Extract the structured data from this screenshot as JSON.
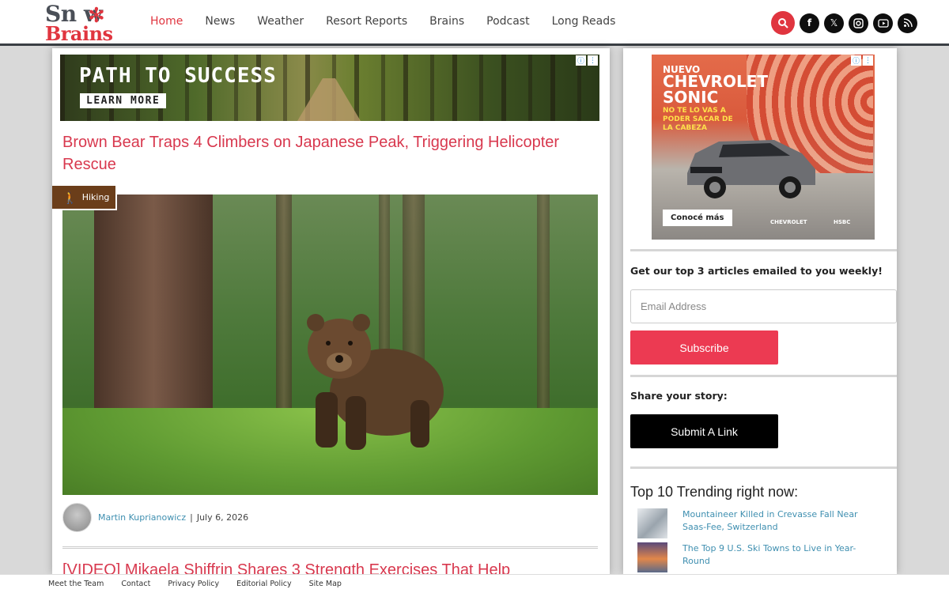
{
  "logo": {
    "line1": "Sn  w",
    "line2": "Brains"
  },
  "nav": {
    "items": [
      {
        "label": "Home",
        "active": true
      },
      {
        "label": "News"
      },
      {
        "label": "Weather"
      },
      {
        "label": "Resort Reports"
      },
      {
        "label": "Brains"
      },
      {
        "label": "Podcast"
      },
      {
        "label": "Long Reads"
      }
    ]
  },
  "social": [
    "search-icon",
    "facebook-icon",
    "x-icon",
    "instagram-icon",
    "youtube-icon",
    "rss-icon"
  ],
  "banner_ad": {
    "headline": "PATH TO SUCCESS",
    "cta": "LEARN MORE"
  },
  "article": {
    "title": "Brown Bear Traps 4 Climbers on Japanese Peak, Triggering Helicopter Rescue",
    "category": "Hiking",
    "author": "Martin Kuprianowicz",
    "date": "July 6, 2026",
    "separator": "|"
  },
  "next_article": {
    "title": "[VIDEO] Mikaela Shiffrin Shares 3 Strength Exercises That Help"
  },
  "side_ad": {
    "line1": "NUEVO",
    "line2": "CHEVROLET SONIC",
    "line3": "NO TE LO VAS A PODER SACAR DE LA CABEZA",
    "cta": "Conocé más",
    "brand1": "CHEVROLET",
    "brand2": "HSBC"
  },
  "newsletter": {
    "heading": "Get our top 3 articles emailed to you weekly!",
    "placeholder": "Email Address",
    "button": "Subscribe"
  },
  "share": {
    "heading": "Share your story:",
    "button": "Submit A Link"
  },
  "trending": {
    "title": "Top 10 Trending right now:",
    "items": [
      {
        "title": "Mountaineer Killed in Crevasse Fall Near Saas-Fee, Switzerland"
      },
      {
        "title": "The Top 9 U.S. Ski Towns to Live in Year-Round"
      }
    ]
  },
  "footer": {
    "links": [
      "Meet the Team",
      "Contact",
      "Privacy Policy",
      "Editorial Policy",
      "Site Map"
    ]
  },
  "colors": {
    "accent": "#e0353f",
    "title": "#d8384e",
    "link": "#3f8fb0",
    "category": "#6b3e1a"
  }
}
